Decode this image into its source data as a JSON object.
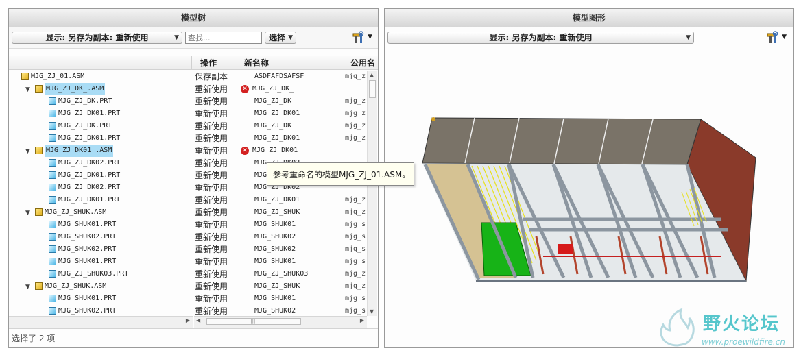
{
  "left_panel": {
    "title": "模型树",
    "display_combo": "显示: 另存为副本: 重新使用",
    "search_placeholder": "查找...",
    "select_label": "选择",
    "columns": {
      "operation": "操作",
      "new_name": "新名称",
      "common_name": "公用名"
    },
    "rows": [
      {
        "name": "MJG_ZJ_01.ASM",
        "type": "asm",
        "level": 0,
        "toggle": "",
        "selected": false,
        "op": "保存副本",
        "new_name": "ASDFAFDSAFSF",
        "error": false,
        "common": "mjg_z"
      },
      {
        "name": "MJG_ZJ_DK_.ASM",
        "type": "asm",
        "level": 1,
        "toggle": "▼",
        "selected": true,
        "op": "重新使用",
        "new_name": "MJG_ZJ_DK_",
        "error": true,
        "common": ""
      },
      {
        "name": "MJG_ZJ_DK.PRT",
        "type": "prt",
        "level": 2,
        "toggle": "",
        "selected": false,
        "op": "重新使用",
        "new_name": "MJG_ZJ_DK",
        "error": false,
        "common": "mjg_z"
      },
      {
        "name": "MJG_ZJ_DK01.PRT",
        "type": "prt",
        "level": 2,
        "toggle": "",
        "selected": false,
        "op": "重新使用",
        "new_name": "MJG_ZJ_DK01",
        "error": false,
        "common": "mjg_z"
      },
      {
        "name": "MJG_ZJ_DK.PRT",
        "type": "prt",
        "level": 2,
        "toggle": "",
        "selected": false,
        "op": "重新使用",
        "new_name": "MJG_ZJ_DK",
        "error": false,
        "common": "mjg_z"
      },
      {
        "name": "MJG_ZJ_DK01.PRT",
        "type": "prt",
        "level": 2,
        "toggle": "",
        "selected": false,
        "op": "重新使用",
        "new_name": "MJG_ZJ_DK01",
        "error": false,
        "common": "mjg_z"
      },
      {
        "name": "MJG_ZJ_DK01_.ASM",
        "type": "asm",
        "level": 1,
        "toggle": "▼",
        "selected": true,
        "op": "重新使用",
        "new_name": "MJG_ZJ_DK01_",
        "error": true,
        "common": ""
      },
      {
        "name": "MJG_ZJ_DK02.PRT",
        "type": "prt",
        "level": 2,
        "toggle": "",
        "selected": false,
        "op": "重新使用",
        "new_name": "MJG_ZJ_DK02",
        "error": false,
        "common": ""
      },
      {
        "name": "MJG_ZJ_DK01.PRT",
        "type": "prt",
        "level": 2,
        "toggle": "",
        "selected": false,
        "op": "重新使用",
        "new_name": "MJG_ZJ_DK01",
        "error": false,
        "common": ""
      },
      {
        "name": "MJG_ZJ_DK02.PRT",
        "type": "prt",
        "level": 2,
        "toggle": "",
        "selected": false,
        "op": "重新使用",
        "new_name": "MJG_ZJ_DK02",
        "error": false,
        "common": ""
      },
      {
        "name": "MJG_ZJ_DK01.PRT",
        "type": "prt",
        "level": 2,
        "toggle": "",
        "selected": false,
        "op": "重新使用",
        "new_name": "MJG_ZJ_DK01",
        "error": false,
        "common": "mjg_z"
      },
      {
        "name": "MJG_ZJ_SHUK.ASM",
        "type": "asm",
        "level": 1,
        "toggle": "▼",
        "selected": false,
        "op": "重新使用",
        "new_name": "MJG_ZJ_SHUK",
        "error": false,
        "common": "mjg_z"
      },
      {
        "name": "MJG_SHUK01.PRT",
        "type": "prt",
        "level": 2,
        "toggle": "",
        "selected": false,
        "op": "重新使用",
        "new_name": "MJG_SHUK01",
        "error": false,
        "common": "mjg_s"
      },
      {
        "name": "MJG_SHUK02.PRT",
        "type": "prt",
        "level": 2,
        "toggle": "",
        "selected": false,
        "op": "重新使用",
        "new_name": "MJG_SHUK02",
        "error": false,
        "common": "mjg_s"
      },
      {
        "name": "MJG_SHUK02.PRT",
        "type": "prt",
        "level": 2,
        "toggle": "",
        "selected": false,
        "op": "重新使用",
        "new_name": "MJG_SHUK02",
        "error": false,
        "common": "mjg_s"
      },
      {
        "name": "MJG_SHUK01.PRT",
        "type": "prt",
        "level": 2,
        "toggle": "",
        "selected": false,
        "op": "重新使用",
        "new_name": "MJG_SHUK01",
        "error": false,
        "common": "mjg_s"
      },
      {
        "name": "MJG_ZJ_SHUK03.PRT",
        "type": "prt",
        "level": 2,
        "toggle": "",
        "selected": false,
        "op": "重新使用",
        "new_name": "MJG_ZJ_SHUK03",
        "error": false,
        "common": "mjg_z"
      },
      {
        "name": "MJG_ZJ_SHUK.ASM",
        "type": "asm",
        "level": 1,
        "toggle": "▼",
        "selected": false,
        "op": "重新使用",
        "new_name": "MJG_ZJ_SHUK",
        "error": false,
        "common": "mjg_z"
      },
      {
        "name": "MJG_SHUK01.PRT",
        "type": "prt",
        "level": 2,
        "toggle": "",
        "selected": false,
        "op": "重新使用",
        "new_name": "MJG_SHUK01",
        "error": false,
        "common": "mjg_s"
      },
      {
        "name": "MJG_SHUK02.PRT",
        "type": "prt",
        "level": 2,
        "toggle": "",
        "selected": false,
        "op": "重新使用",
        "new_name": "MJG_SHUK02",
        "error": false,
        "common": "mjg_s"
      }
    ],
    "tooltip": "参考重命名的模型MJG_ZJ_01.ASM。",
    "status": "选择了 2 项"
  },
  "right_panel": {
    "title": "模型图形",
    "display_combo": "显示: 另存为副本: 重新使用"
  },
  "watermark": {
    "title": "野火论坛",
    "url": "www.proewildfire.cn"
  },
  "colors": {
    "selection": "#a9dcf5",
    "error": "#d32121",
    "frame": "#8c96a0",
    "wall": "#8a3a2a",
    "roof": "#7a7368"
  }
}
